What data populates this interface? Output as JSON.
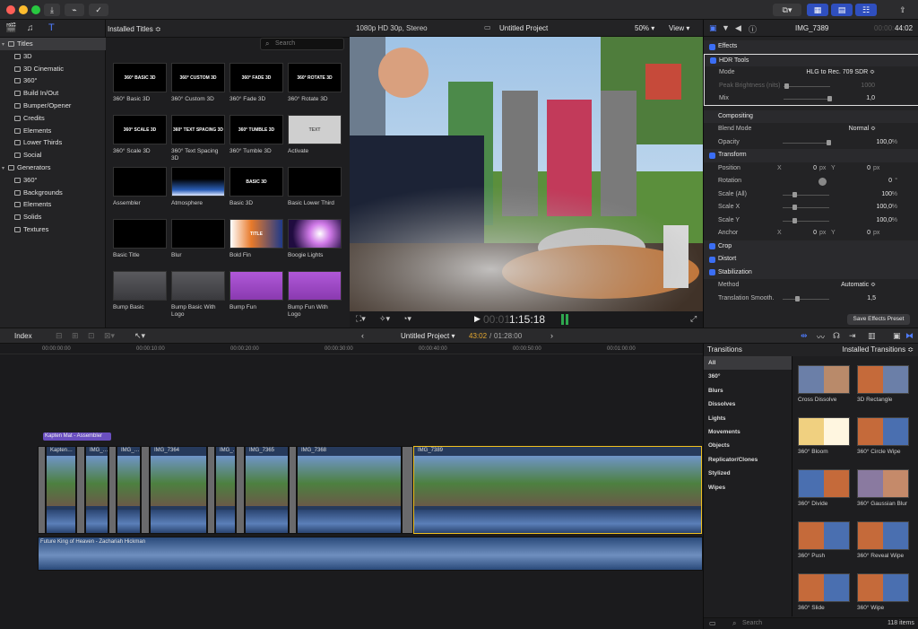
{
  "toolbar": {
    "save_label": "⤓",
    "key_label": "⌁",
    "check_label": "✓"
  },
  "library": {
    "items": [
      {
        "label": "Titles",
        "indent": 0,
        "sel": true,
        "disc": "▾"
      },
      {
        "label": "3D",
        "indent": 1
      },
      {
        "label": "3D Cinematic",
        "indent": 1
      },
      {
        "label": "360°",
        "indent": 1
      },
      {
        "label": "Build In/Out",
        "indent": 1
      },
      {
        "label": "Bumper/Opener",
        "indent": 1
      },
      {
        "label": "Credits",
        "indent": 1
      },
      {
        "label": "Elements",
        "indent": 1
      },
      {
        "label": "Lower Thirds",
        "indent": 1
      },
      {
        "label": "Social",
        "indent": 1
      },
      {
        "label": "Generators",
        "indent": 0,
        "disc": "▾"
      },
      {
        "label": "360°",
        "indent": 1
      },
      {
        "label": "Backgrounds",
        "indent": 1
      },
      {
        "label": "Elements",
        "indent": 1
      },
      {
        "label": "Solids",
        "indent": 1
      },
      {
        "label": "Textures",
        "indent": 1
      }
    ]
  },
  "browser": {
    "title": "Installed Titles",
    "search_placeholder": "Search",
    "tiles": [
      {
        "label": "360° Basic 3D",
        "thumb": "360° BASIC 3D"
      },
      {
        "label": "360° Custom 3D",
        "thumb": "360° CUSTOM 3D"
      },
      {
        "label": "360° Fade 3D",
        "thumb": "360° FADE 3D"
      },
      {
        "label": "360° Rotate 3D",
        "thumb": "360° ROTATE 3D"
      },
      {
        "label": "360° Scale 3D",
        "thumb": "360° SCALE 3D"
      },
      {
        "label": "360° Text Spacing 3D",
        "thumb": "360° TEXT SPACING 3D"
      },
      {
        "label": "360° Tumble 3D",
        "thumb": "360° TUMBLE 3D"
      },
      {
        "label": "Activate",
        "thumb": "TEXT"
      },
      {
        "label": "Assembler",
        "thumb": ""
      },
      {
        "label": "Atmosphere",
        "thumb": ""
      },
      {
        "label": "Basic 3D",
        "thumb": "BASIC 3D"
      },
      {
        "label": "Basic Lower Third",
        "thumb": ""
      },
      {
        "label": "Basic Title",
        "thumb": ""
      },
      {
        "label": "Blur",
        "thumb": ""
      },
      {
        "label": "Bold Fin",
        "thumb": "TITLE"
      },
      {
        "label": "Boogie Lights",
        "thumb": ""
      },
      {
        "label": "Bump Basic",
        "thumb": ""
      },
      {
        "label": "Bump Basic With Logo",
        "thumb": ""
      },
      {
        "label": "Bump Fun",
        "thumb": ""
      },
      {
        "label": "Bump Fun With Logo",
        "thumb": ""
      }
    ]
  },
  "viewer": {
    "format": "1080p HD 30p, Stereo",
    "project": "Untitled Project",
    "zoom": "50%",
    "view": "View",
    "timecode_dim": "00:01",
    "timecode": "1:15:18"
  },
  "inspector": {
    "clip_name": "IMG_7389",
    "duration_dim": "00:00:",
    "duration": "44:02",
    "rows": [
      {
        "type": "sec",
        "name": "Effects",
        "check": true
      },
      {
        "type": "sec",
        "name": "HDR Tools",
        "check": true,
        "boxed": true
      },
      {
        "type": "row",
        "name": "Mode",
        "value": "HLG to Rec. 709 SDR ≎",
        "boxed": true
      },
      {
        "type": "row",
        "name": "Peak Brightness (nits)",
        "value": "1000",
        "dim": true,
        "slider": true,
        "knob": 0.05,
        "boxed": true
      },
      {
        "type": "row",
        "name": "Mix",
        "value": "1,0",
        "slider": true,
        "knob": 0.98,
        "boxed": true
      },
      {
        "type": "gap"
      },
      {
        "type": "sec",
        "name": "Compositing"
      },
      {
        "type": "row",
        "name": "Blend Mode",
        "value": "Normal ≎"
      },
      {
        "type": "row",
        "name": "Opacity",
        "value": "100,0",
        "unit": "%",
        "slider": true,
        "knob": 0.98
      },
      {
        "type": "sec",
        "name": "Transform",
        "check": true
      },
      {
        "type": "xy",
        "name": "Position",
        "x": "0",
        "xu": "px",
        "y": "0",
        "yu": "px"
      },
      {
        "type": "row",
        "name": "Rotation",
        "value": "0",
        "unit": "°",
        "dial": true
      },
      {
        "type": "row",
        "name": "Scale (All)",
        "value": "100",
        "unit": "%",
        "slider": true,
        "knob": 0.25
      },
      {
        "type": "row",
        "name": "Scale X",
        "value": "100,0",
        "unit": "%",
        "slider": true,
        "knob": 0.25
      },
      {
        "type": "row",
        "name": "Scale Y",
        "value": "100,0",
        "unit": "%",
        "slider": true,
        "knob": 0.25
      },
      {
        "type": "xy",
        "name": "Anchor",
        "x": "0",
        "xu": "px",
        "y": "0",
        "yu": "px"
      },
      {
        "type": "sec",
        "name": "Crop",
        "check": true
      },
      {
        "type": "sec",
        "name": "Distort",
        "check": true
      },
      {
        "type": "sec",
        "name": "Stabilization",
        "check": true
      },
      {
        "type": "row",
        "name": "Method",
        "value": "Automatic ≎"
      },
      {
        "type": "row",
        "name": "Translation Smooth.",
        "value": "1,5",
        "slider": true,
        "knob": 0.3
      }
    ],
    "save_preset": "Save Effects Preset"
  },
  "timeline": {
    "index": "Index",
    "project": "Untitled Project",
    "position": "43:02",
    "duration": "01:28:00",
    "ruler": [
      "00:00:00:00",
      "00:00:10:00",
      "00:00:20:00",
      "00:00:30:00",
      "00:00:40:00",
      "00:00:50:00",
      "00:01:00:00"
    ],
    "title_clip": "Kapten Mat - Assembler",
    "clips": [
      {
        "label": "Kapten…"
      },
      {
        "label": "IMG_…"
      },
      {
        "label": "IMG_…"
      },
      {
        "label": "IMG_7364"
      },
      {
        "label": "IMG_…"
      },
      {
        "label": "IMG_7365"
      },
      {
        "label": "IMG_7368"
      },
      {
        "label": "IMG_7389"
      }
    ],
    "music": "Future King of Heaven - Zachariah Hickman"
  },
  "transitions": {
    "title": "Transitions",
    "installed": "Installed Transitions",
    "categories": [
      "All",
      "360°",
      "Blurs",
      "Dissolves",
      "Lights",
      "Movements",
      "Objects",
      "Replicator/Clones",
      "Stylized",
      "Wipes"
    ],
    "tiles": [
      {
        "label": "Cross Dissolve",
        "c1": "#6b7fa8",
        "c2": "#b98a6a"
      },
      {
        "label": "3D Rectangle",
        "c1": "#c56a3a",
        "c2": "#6b7fa8"
      },
      {
        "label": "360° Bloom",
        "c1": "#f0d080",
        "c2": "#fff6e0"
      },
      {
        "label": "360° Circle Wipe",
        "c1": "#c56a3a",
        "c2": "#4a6fb0"
      },
      {
        "label": "360° Divide",
        "c1": "#4a6fb0",
        "c2": "#c56a3a"
      },
      {
        "label": "360° Gaussian Blur",
        "c1": "#8a7aa0",
        "c2": "#c58a6a"
      },
      {
        "label": "360° Push",
        "c1": "#c56a3a",
        "c2": "#4a6fb0"
      },
      {
        "label": "360° Reveal Wipe",
        "c1": "#c56a3a",
        "c2": "#4a6fb0"
      },
      {
        "label": "360° Slide",
        "c1": "#c56a3a",
        "c2": "#4a6fb0"
      },
      {
        "label": "360° Wipe",
        "c1": "#c56a3a",
        "c2": "#4a6fb0"
      }
    ],
    "search_placeholder": "Search",
    "count": "118 items"
  }
}
